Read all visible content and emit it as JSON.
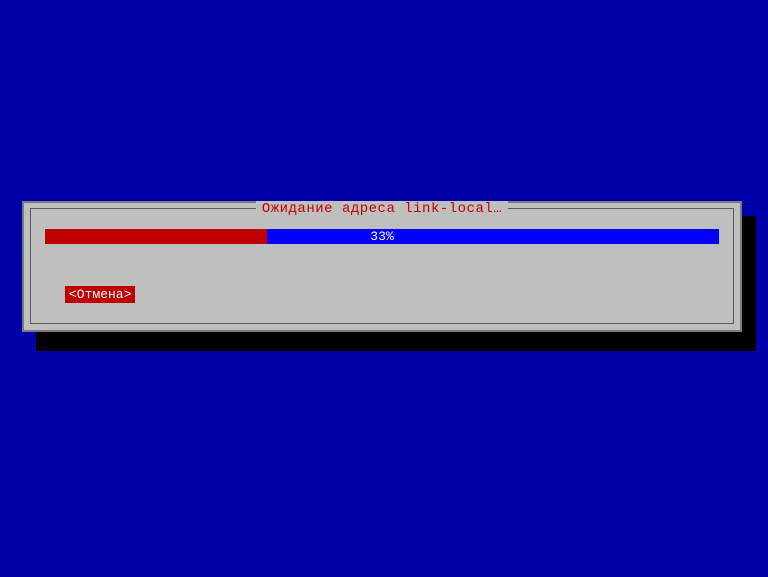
{
  "dialog": {
    "title": "Ожидание адреса link-local…",
    "progress": {
      "percent": 33,
      "label": "33%"
    },
    "cancel_label": "<Отмена>"
  },
  "colors": {
    "background": "#0000a8",
    "dialog_bg": "#bfbfbf",
    "progress_bg": "#0000ff",
    "progress_fill": "#c00000",
    "accent": "#c00000"
  }
}
